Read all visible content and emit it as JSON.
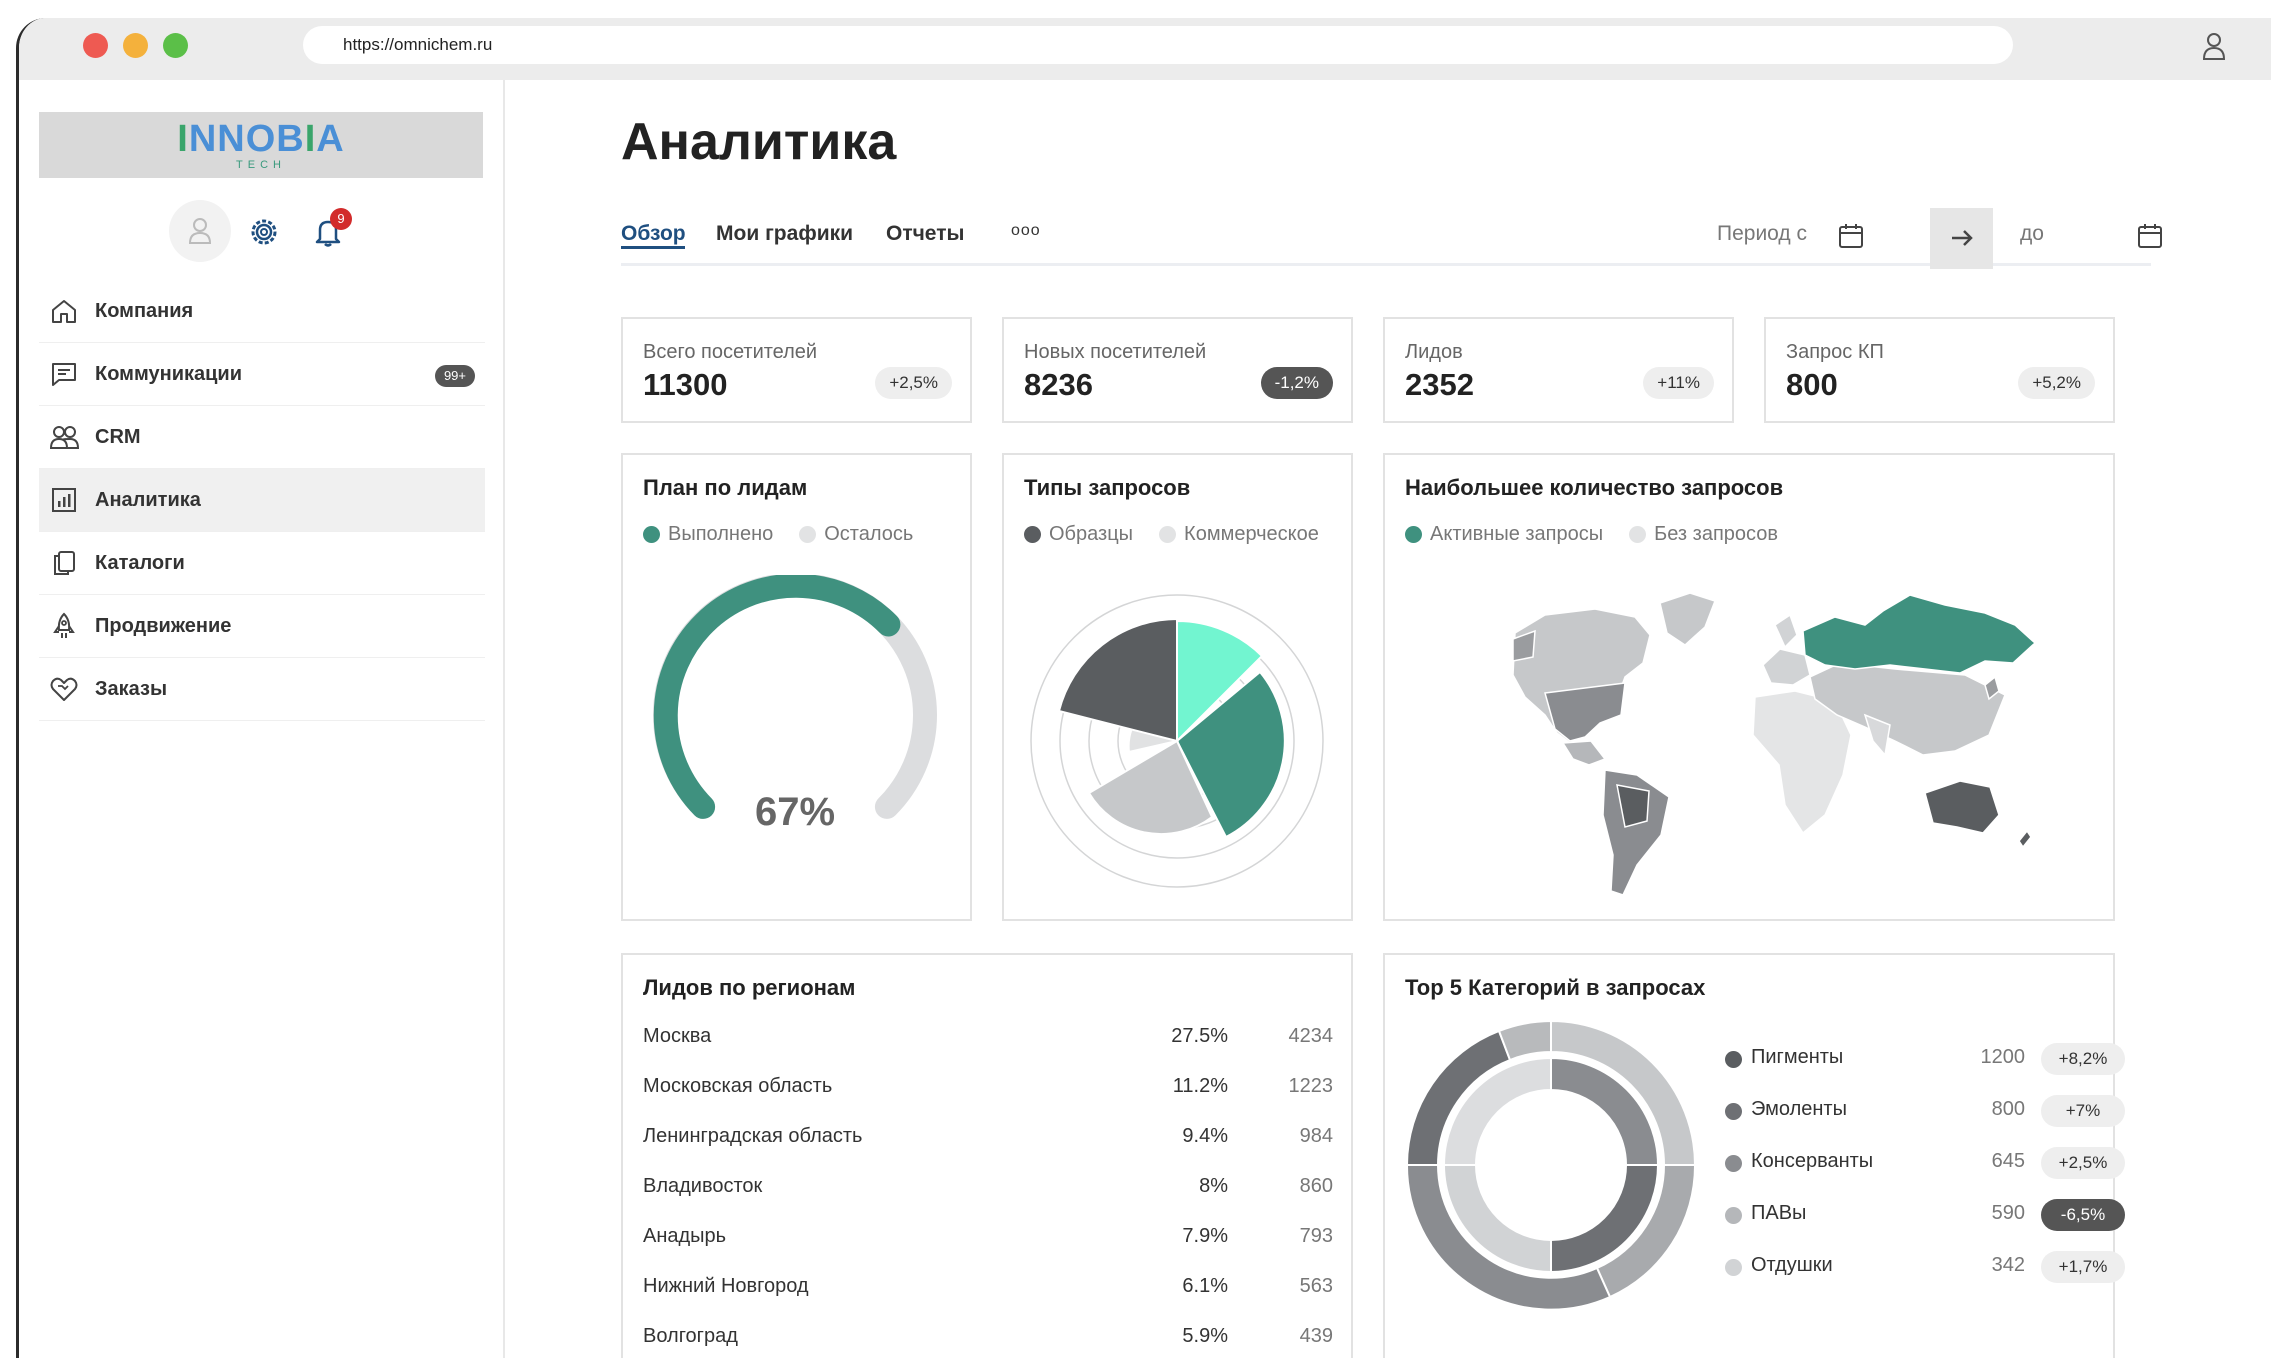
{
  "browser": {
    "url": "https://omnichem.ru"
  },
  "sidebar": {
    "logo_main": "NNOB",
    "logo_first": "I",
    "logo_rest": "A",
    "logo_sub": "TECH",
    "notifications_count": "9",
    "items": [
      {
        "label": "Компания",
        "icon": "home-icon"
      },
      {
        "label": "Коммуникации",
        "icon": "chat-icon",
        "badge": "99+"
      },
      {
        "label": "CRM",
        "icon": "users-icon"
      },
      {
        "label": "Аналитика",
        "icon": "analytics-icon",
        "active": true
      },
      {
        "label": "Каталоги",
        "icon": "catalog-icon"
      },
      {
        "label": "Продвижение",
        "icon": "rocket-icon"
      },
      {
        "label": "Заказы",
        "icon": "handshake-icon"
      }
    ]
  },
  "page": {
    "title": "Аналитика",
    "tabs": [
      "Обзор",
      "Мои графики",
      "Отчеты"
    ],
    "more": "ooo",
    "period_from": "Период с",
    "period_to": "до"
  },
  "kpis": [
    {
      "label": "Всего посетителей",
      "value": "11300",
      "delta": "+2,5%",
      "negative": false
    },
    {
      "label": "Новых посетителей",
      "value": "8236",
      "delta": "-1,2%",
      "negative": true
    },
    {
      "label": "Лидов",
      "value": "2352",
      "delta": "+11%",
      "negative": false
    },
    {
      "label": "Запрос КП",
      "value": "800",
      "delta": "+5,2%",
      "negative": false
    }
  ],
  "plan": {
    "title": "План по лидам",
    "legend": [
      "Выполнено",
      "Осталось"
    ],
    "value_text": "67%",
    "fraction": 0.67
  },
  "request_types": {
    "title": "Типы запросов",
    "legend": [
      "Образцы",
      "Коммерческое"
    ]
  },
  "map": {
    "title": "Наибольшее количество запросов",
    "legend": [
      "Активные запросы",
      "Без запросов"
    ]
  },
  "regions": {
    "title": "Лидов по регионам",
    "rows": [
      {
        "name": "Москва",
        "pct": "27.5%",
        "value": "4234"
      },
      {
        "name": "Московская область",
        "pct": "11.2%",
        "value": "1223"
      },
      {
        "name": "Ленинградская область",
        "pct": "9.4%",
        "value": "984"
      },
      {
        "name": "Владивосток",
        "pct": "8%",
        "value": "860"
      },
      {
        "name": "Анадырь",
        "pct": "7.9%",
        "value": "793"
      },
      {
        "name": "Нижний Новгород",
        "pct": "6.1%",
        "value": "563"
      },
      {
        "name": "Волгоград",
        "pct": "5.9%",
        "value": "439"
      }
    ]
  },
  "categories": {
    "title": "Top 5 Категорий в запросах",
    "rows": [
      {
        "name": "Пигменты",
        "value": "1200",
        "delta": "+8,2%",
        "negative": false
      },
      {
        "name": "Эмоленты",
        "value": "800",
        "delta": "+7%",
        "negative": false
      },
      {
        "name": "Консерванты",
        "value": "645",
        "delta": "+2,5%",
        "negative": false
      },
      {
        "name": "ПАВы",
        "value": "590",
        "delta": "-6,5%",
        "negative": true
      },
      {
        "name": "Отдушки",
        "value": "342",
        "delta": "+1,7%",
        "negative": false
      }
    ]
  },
  "colors": {
    "accent": "#3f917f",
    "mint": "#72f5d0",
    "dark": "#5a5d60",
    "light": "#c6c8ca",
    "track": "#dcdddf",
    "active_tab": "#1f4f80"
  }
}
